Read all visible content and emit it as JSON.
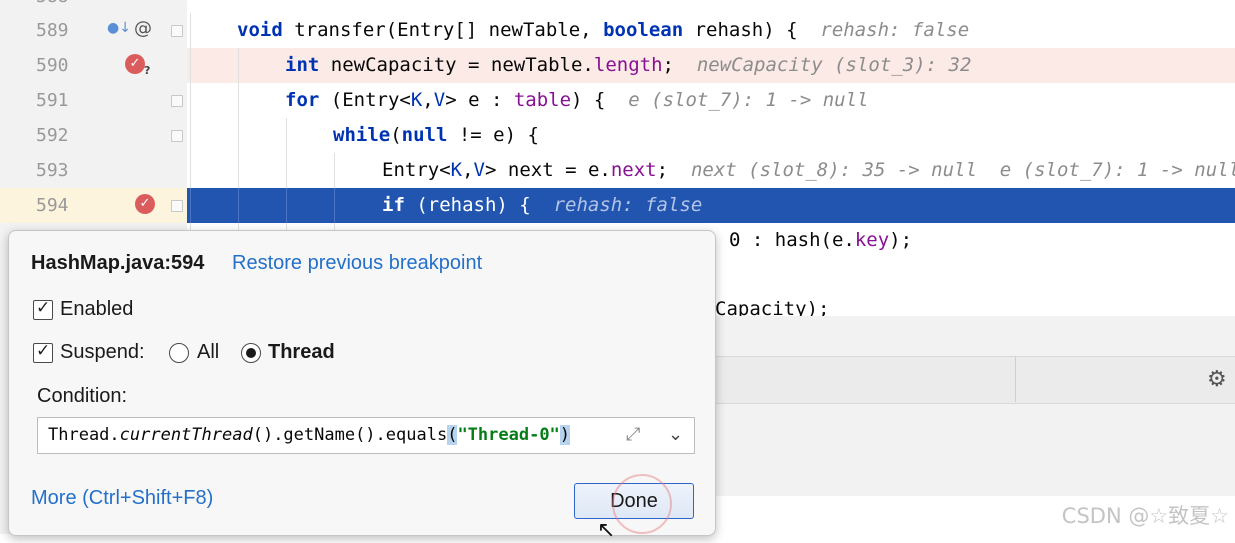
{
  "editor": {
    "top_line_number": "588",
    "lines": [
      {
        "number": "589",
        "tokens": [
          {
            "t": "void",
            "c": "kw"
          },
          {
            "t": " transfer(Entry[] newTable, "
          },
          {
            "t": "boolean",
            "c": "kw"
          },
          {
            "t": " rehash) {  "
          },
          {
            "t": "rehash: false",
            "c": "hint"
          }
        ]
      },
      {
        "number": "590",
        "tokens": [
          {
            "t": "int",
            "c": "kw"
          },
          {
            "t": " newCapacity = newTable."
          },
          {
            "t": "length",
            "c": "fld"
          },
          {
            "t": ";  "
          },
          {
            "t": "newCapacity (slot_3): 32",
            "c": "hint"
          }
        ]
      },
      {
        "number": "591",
        "tokens": [
          {
            "t": "for",
            "c": "kw"
          },
          {
            "t": " (Entry<"
          },
          {
            "t": "K",
            "c": "typ"
          },
          {
            "t": ","
          },
          {
            "t": "V",
            "c": "typ"
          },
          {
            "t": "> e : "
          },
          {
            "t": "table",
            "c": "fld"
          },
          {
            "t": ") {  "
          },
          {
            "t": "e (slot_7): 1 -> null",
            "c": "hint"
          }
        ]
      },
      {
        "number": "592",
        "tokens": [
          {
            "t": "while",
            "c": "kw"
          },
          {
            "t": "("
          },
          {
            "t": "null",
            "c": "kw"
          },
          {
            "t": " != e) {"
          }
        ]
      },
      {
        "number": "593",
        "tokens": [
          {
            "t": "Entry<"
          },
          {
            "t": "K",
            "c": "typ"
          },
          {
            "t": ","
          },
          {
            "t": "V",
            "c": "typ"
          },
          {
            "t": "> next = e."
          },
          {
            "t": "next",
            "c": "fld"
          },
          {
            "t": ";  "
          },
          {
            "t": "next (slot_8): 35 -> null  e (slot_7): 1 -> null",
            "c": "hint"
          }
        ]
      },
      {
        "number": "594",
        "tokens": [
          {
            "t": "if",
            "c": "kw"
          },
          {
            "t": " (rehash) {  "
          },
          {
            "t": "rehash: false",
            "c": "hint"
          }
        ]
      },
      {
        "number": "595",
        "tokens": [
          {
            "t": "0 : hash(e."
          },
          {
            "t": "key",
            "c": "fld"
          },
          {
            "t": ");"
          }
        ]
      },
      {
        "number": "596",
        "tokens": []
      },
      {
        "number": "597",
        "tokens": [
          {
            "t": "Capacity);"
          }
        ]
      }
    ]
  },
  "popup": {
    "title": "HashMap.java:594",
    "restore_link": "Restore previous breakpoint",
    "enabled_label": "Enabled",
    "enabled_checked": true,
    "suspend_label": "Suspend:",
    "suspend_checked": true,
    "suspend_options": [
      "All",
      "Thread"
    ],
    "suspend_selected": "Thread",
    "condition_label": "Condition:",
    "condition": {
      "part1": "Thread.",
      "part2": "currentThread",
      "part3": "().getName().equals",
      "part4": "(",
      "part5": "\"Thread-0\"",
      "part6": ")"
    },
    "more_link": "More (Ctrl+Shift+F8)",
    "done_label": "Done"
  },
  "watermark": "CSDN @☆致夏☆",
  "icons": {
    "breakpoint": "breakpoint-conditional-icon",
    "selected_breakpoint": "breakpoint-selected-icon",
    "settings": "gear-icon"
  },
  "colors": {
    "selection": "#2155b0",
    "highlight": "#fbeae5",
    "link": "#2470c9",
    "keyword": "#0033b3"
  }
}
